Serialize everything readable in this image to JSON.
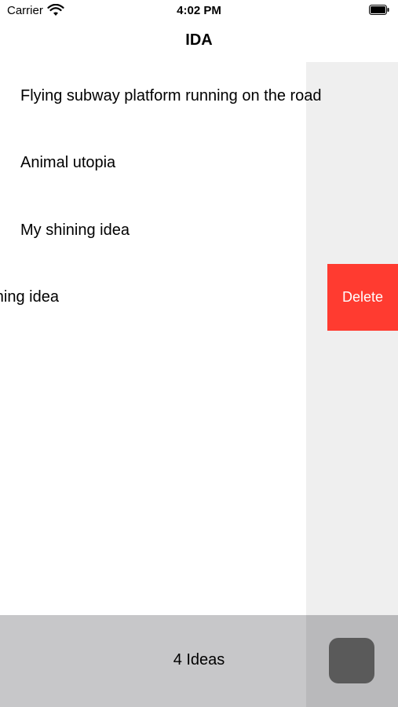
{
  "status_bar": {
    "carrier": "Carrier",
    "time": "4:02 PM",
    "wifi_icon": "wifi-icon",
    "battery_icon": "battery-icon"
  },
  "nav": {
    "title": "IDA"
  },
  "ideas": [
    {
      "title": "Flying subway platform running on the road"
    },
    {
      "title": "Animal utopia"
    },
    {
      "title": "My shining idea"
    },
    {
      "title": "My shining idea",
      "swiped": true,
      "visible_text": "hining idea"
    }
  ],
  "row_actions": {
    "delete_label": "Delete",
    "delete_color": "#ff3b30"
  },
  "toolbar": {
    "count_label": "4 Ideas",
    "action_icon": "rounded-square-button"
  },
  "colors": {
    "side_panel": "#efefef",
    "toolbar": "#c7c7c9",
    "action_button": "#5a5a5a"
  }
}
